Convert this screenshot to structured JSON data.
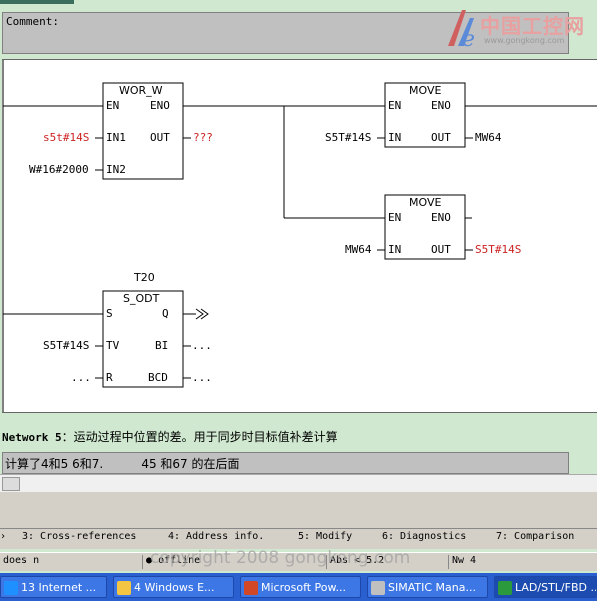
{
  "comment": {
    "label": "Comment:"
  },
  "logo": {
    "text": "中国工控网",
    "url": "www.gongkong.com"
  },
  "blocks": {
    "wor": {
      "title": "WOR_W",
      "en": "EN",
      "eno": "ENO",
      "in1": "IN1",
      "in2": "IN2",
      "out": "OUT",
      "in1_val": "s5t#14S",
      "in2_val": "W#16#2000",
      "out_val": "???"
    },
    "move1": {
      "title": "MOVE",
      "en": "EN",
      "eno": "ENO",
      "in": "IN",
      "out": "OUT",
      "in_val": "S5T#14S",
      "out_val": "MW64"
    },
    "move2": {
      "title": "MOVE",
      "en": "EN",
      "eno": "ENO",
      "in": "IN",
      "out": "OUT",
      "in_val": "MW64",
      "out_val": "S5T#14S"
    },
    "timer": {
      "name": "T20",
      "title": "S_ODT",
      "s": "S",
      "q": "Q",
      "tv": "TV",
      "bi": "BI",
      "r": "R",
      "bcd": "BCD",
      "tv_val": "S5T#14S",
      "r_val": "...",
      "bi_val": "...",
      "bcd_val": "..."
    }
  },
  "network5": {
    "label": "Network 5",
    "title": "：运动过程中位置的差。用于同步时目标值补差计算",
    "comment": "计算了4和5 6和7.          45 和67 的在后面"
  },
  "tabs": [
    {
      "label": "3: Cross-references"
    },
    {
      "label": "4: Address info."
    },
    {
      "label": "5: Modify"
    },
    {
      "label": "6: Diagnostics"
    },
    {
      "label": "7: Comparison"
    }
  ],
  "status": {
    "left": "does n",
    "mode": "offline",
    "abs": "Abs < 5.2",
    "nw": "Nw 4"
  },
  "watermark": "copyright 2008 gongkong.com",
  "taskbar": [
    {
      "label": "13 Internet ...",
      "color": "#1e90ff"
    },
    {
      "label": "4 Windows E...",
      "color": "#f4c542"
    },
    {
      "label": "Microsoft Pow...",
      "color": "#d24726"
    },
    {
      "label": "SIMATIC Mana...",
      "color": "#c0c0c0"
    },
    {
      "label": "LAD/STL/FBD ...",
      "color": "#2b9a3c"
    }
  ]
}
